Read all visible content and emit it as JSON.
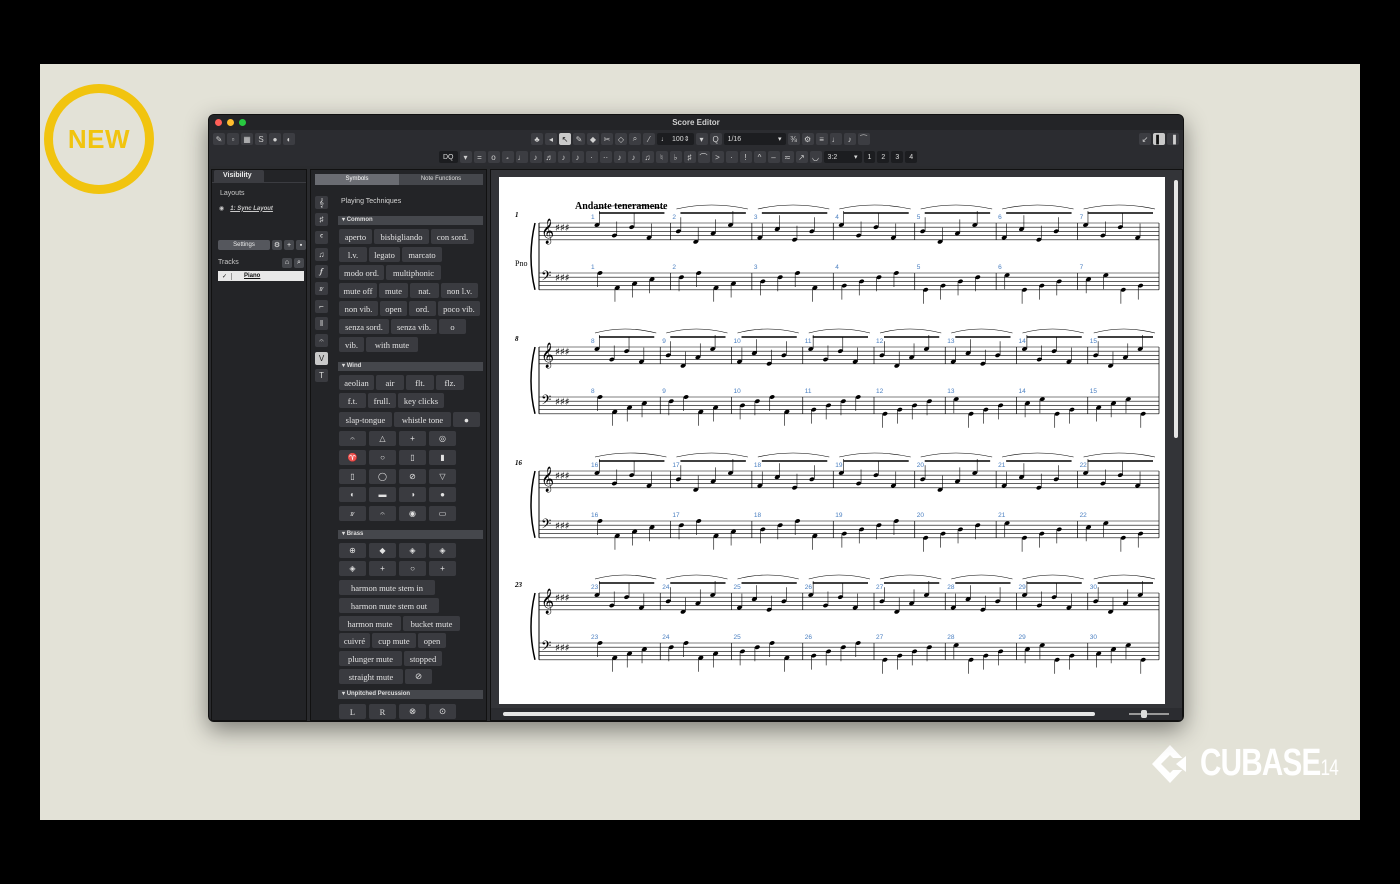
{
  "badge": {
    "text": "NEW"
  },
  "brand": {
    "name": "CUBASE",
    "version": "14"
  },
  "window": {
    "title": "Score Editor"
  },
  "toolbar": {
    "velocity": "100",
    "quantize": "1/16",
    "dq": "DQ",
    "tuplet": "3:2",
    "voices": [
      "1",
      "2",
      "3",
      "4"
    ]
  },
  "visibility": {
    "tab": "Visibility",
    "layouts_label": "Layouts",
    "layout_item": "1: Sync Layout",
    "settings_label": "Settings",
    "tracks_label": "Tracks",
    "track_name": "Piano"
  },
  "symbols": {
    "tabs": [
      "Symbols",
      "Note Functions"
    ],
    "panel_title": "Playing Techniques",
    "sections": {
      "common": "Common",
      "wind": "Wind",
      "brass": "Brass",
      "unpitched": "Unpitched Percussion"
    },
    "common": [
      "aperto",
      "bisbigliando",
      "con sord.",
      "l.v.",
      "legato",
      "marcato",
      "modo ord.",
      "multiphonic",
      "mute off",
      "mute",
      "nat.",
      "non l.v.",
      "non vib.",
      "open",
      "ord.",
      "poco vib.",
      "senza sord.",
      "senza vib.",
      "o",
      "vib.",
      "with mute"
    ],
    "wind": [
      "aeolian",
      "air",
      "flt.",
      "flz.",
      "f.t.",
      "frull.",
      "key clicks",
      "slap-tongue",
      "whistle tone",
      "●"
    ],
    "brass_text": [
      "harmon mute stem in",
      "harmon mute stem out",
      "harmon mute",
      "bucket mute",
      "cuivré",
      "cup mute",
      "open",
      "plunger mute",
      "stopped",
      "straight mute",
      "⊘"
    ],
    "perc": [
      "L",
      "R",
      "⊗",
      "⊙"
    ]
  },
  "score": {
    "tempo": "Andante teneramente",
    "instrument": "Pno",
    "systems": [
      {
        "first_bar": "1",
        "bars": [
          "1",
          "2",
          "3",
          "4",
          "5",
          "6",
          "7"
        ]
      },
      {
        "first_bar": "8",
        "bars": [
          "8",
          "9",
          "10",
          "11",
          "12",
          "13",
          "14",
          "15"
        ]
      },
      {
        "first_bar": "16",
        "bars": [
          "16",
          "17",
          "18",
          "19",
          "20",
          "21",
          "22"
        ]
      },
      {
        "first_bar": "23",
        "bars": [
          "23",
          "24",
          "25",
          "26",
          "27",
          "28",
          "29",
          "30"
        ]
      }
    ]
  },
  "colors": {
    "accent": "#f1c40f",
    "bar_number": "#4a7fc1"
  }
}
